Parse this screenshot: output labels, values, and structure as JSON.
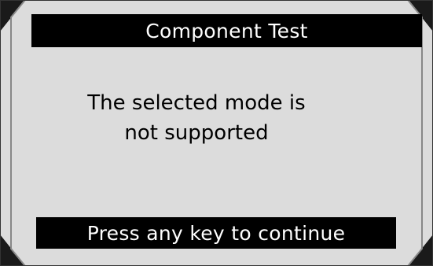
{
  "header": {
    "title": "Component Test"
  },
  "message": {
    "line1": "The selected mode is",
    "line2": "not supported"
  },
  "footer": {
    "prompt": "Press any key to continue"
  },
  "colors": {
    "screen_background": "#dcdcdc",
    "bar_background": "#000000",
    "bar_text": "#ffffff",
    "body_text": "#000000"
  }
}
